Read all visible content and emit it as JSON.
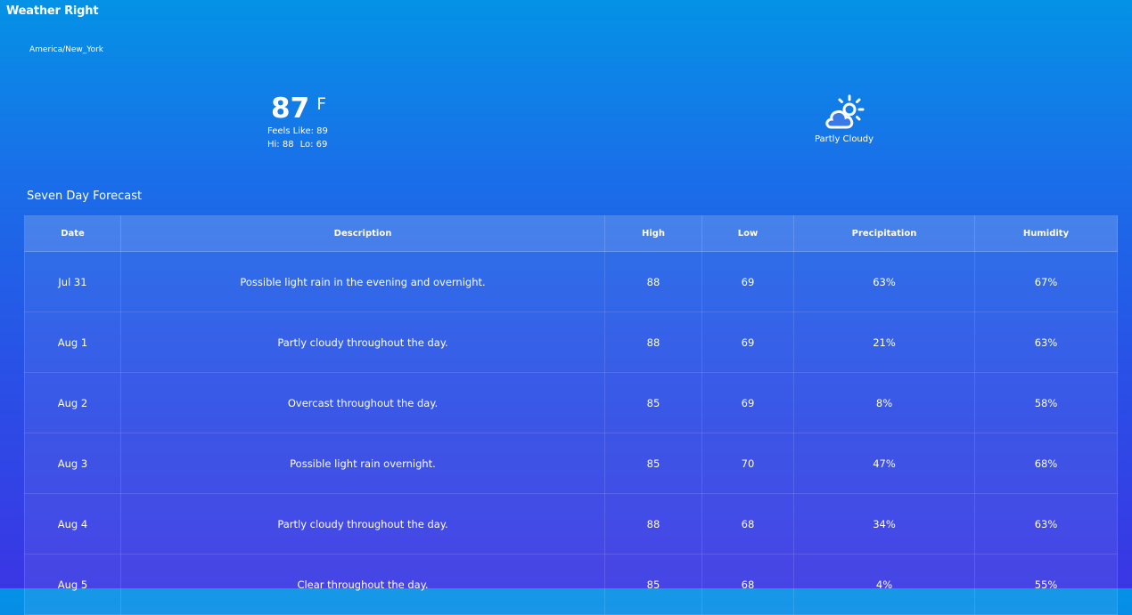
{
  "app": {
    "title": "Weather Right"
  },
  "location": {
    "timezone": "America/New_York"
  },
  "current": {
    "temp": "87",
    "unit": "F",
    "feels_like": "Feels Like: 89",
    "hi": "Hi: 88",
    "lo": "Lo: 69",
    "condition": "Partly Cloudy",
    "icon": "partly-cloudy-icon"
  },
  "forecast": {
    "title": "Seven Day Forecast",
    "columns": [
      "Date",
      "Description",
      "High",
      "Low",
      "Precipitation",
      "Humidity"
    ],
    "rows": [
      [
        "Jul 31",
        "Possible light rain in the evening and overnight.",
        "88",
        "69",
        "63%",
        "67%"
      ],
      [
        "Aug 1",
        "Partly cloudy throughout the day.",
        "88",
        "69",
        "21%",
        "63%"
      ],
      [
        "Aug 2",
        "Overcast throughout the day.",
        "85",
        "69",
        "8%",
        "58%"
      ],
      [
        "Aug 3",
        "Possible light rain overnight.",
        "85",
        "70",
        "47%",
        "68%"
      ],
      [
        "Aug 4",
        "Partly cloudy throughout the day.",
        "88",
        "68",
        "34%",
        "63%"
      ],
      [
        "Aug 5",
        "Clear throughout the day.",
        "85",
        "68",
        "4%",
        "55%"
      ]
    ]
  }
}
